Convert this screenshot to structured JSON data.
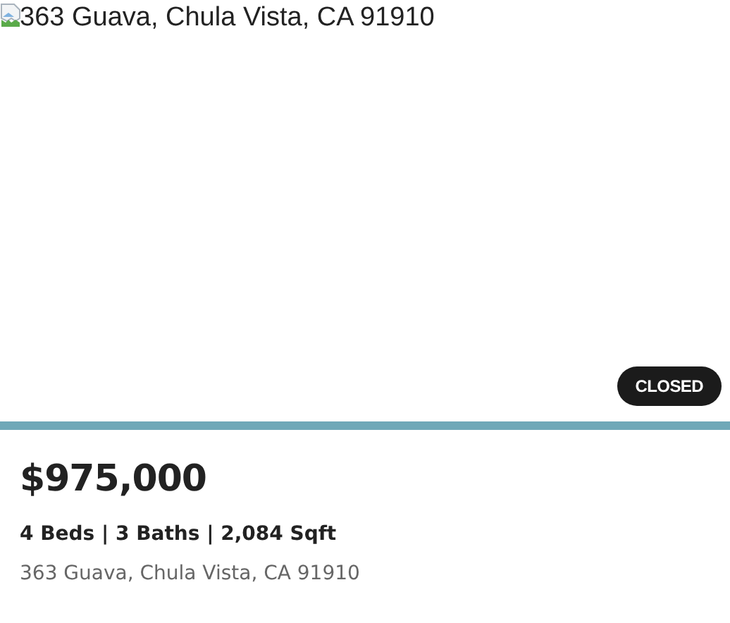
{
  "listing": {
    "image_alt": "363 Guava, Chula Vista, CA 91910",
    "status": "CLOSED",
    "price": "$975,000",
    "details": "4 Beds | 3 Baths | 2,084 Sqft",
    "address": "363 Guava, Chula Vista, CA 91910"
  }
}
